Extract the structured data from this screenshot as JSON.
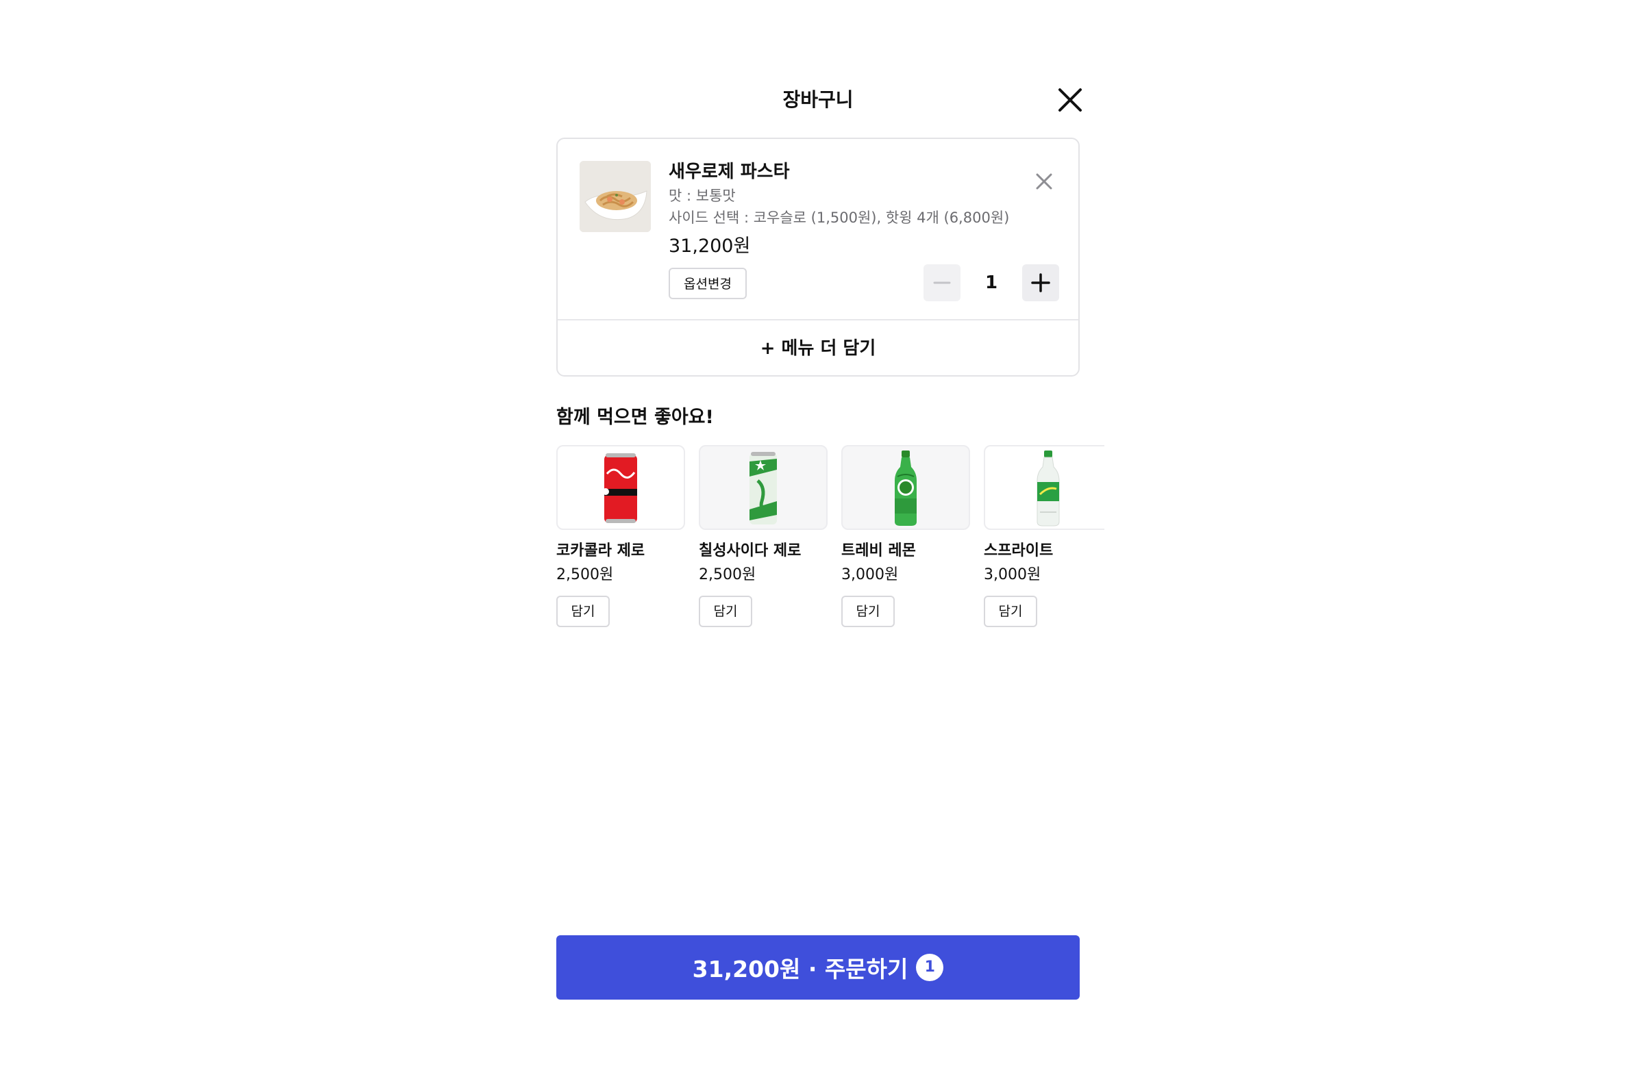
{
  "header": {
    "title": "장바구니",
    "close_icon": "close-icon"
  },
  "cart": {
    "items": [
      {
        "name": "새우로제 파스타",
        "options": [
          "맛 : 보통맛",
          "사이드 선택 : 코우슬로 (1,500원), 핫윙 4개 (6,800원)"
        ],
        "price": "31,200원",
        "quantity": "1",
        "option_change_label": "옵션변경",
        "image_icon": "pasta-dish-image"
      }
    ],
    "add_more_label": "+ 메뉴 더 담기"
  },
  "recommend": {
    "title": "함께 먹으면 좋아요!",
    "items": [
      {
        "name": "코카콜라 제로",
        "price": "2,500원",
        "add_label": "담기",
        "image_icon": "coca-cola-can-image"
      },
      {
        "name": "칠성사이다 제로",
        "price": "2,500원",
        "add_label": "담기",
        "image_icon": "chilsung-cider-can-image"
      },
      {
        "name": "트레비 레몬",
        "price": "3,000원",
        "add_label": "담기",
        "image_icon": "trevi-bottle-image"
      },
      {
        "name": "스프라이트",
        "price": "3,000원",
        "add_label": "담기",
        "image_icon": "sprite-bottle-image"
      }
    ]
  },
  "order": {
    "label": "31,200원 · 주문하기",
    "count": "1"
  },
  "colors": {
    "primary": "#3f4fdb",
    "border": "#e3e3e6",
    "muted_text": "#6b6b6f"
  }
}
